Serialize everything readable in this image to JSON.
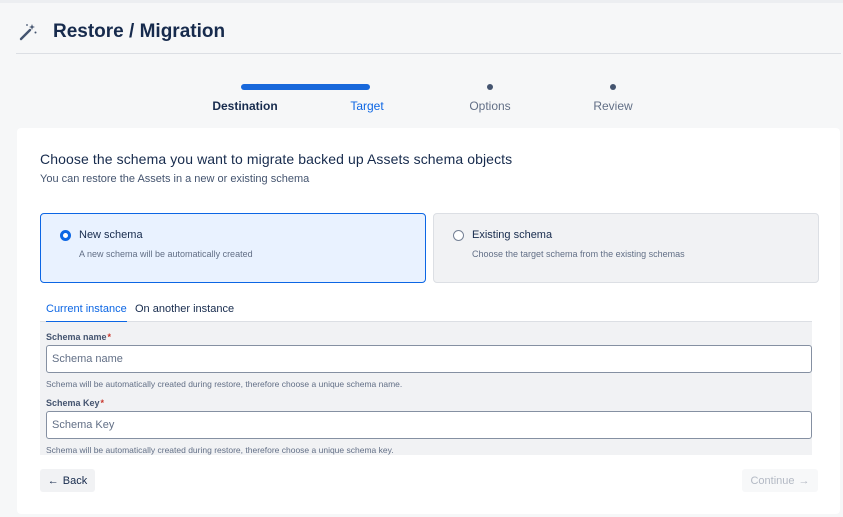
{
  "header": {
    "title": "Restore / Migration",
    "icon": "magic-wand-icon"
  },
  "steps": [
    {
      "label": "Destination",
      "state": "done"
    },
    {
      "label": "Target",
      "state": "active"
    },
    {
      "label": "Options",
      "state": "pending"
    },
    {
      "label": "Review",
      "state": "pending"
    }
  ],
  "main": {
    "heading": "Choose the schema you want to migrate backed up Assets schema objects",
    "subheading": "You can restore the Assets in a new or existing schema",
    "options": [
      {
        "title": "New schema",
        "description": "A new schema will be automatically created",
        "selected": true
      },
      {
        "title": "Existing schema",
        "description": "Choose the target schema from the existing schemas",
        "selected": false
      }
    ],
    "tabs": [
      {
        "label": "Current instance",
        "active": true
      },
      {
        "label": "On another instance",
        "active": false
      }
    ],
    "fields": {
      "schema_name": {
        "label": "Schema name",
        "required_mark": "*",
        "placeholder": "Schema name",
        "value": "",
        "help": "Schema will be automatically created during restore, therefore choose a unique schema name."
      },
      "schema_key": {
        "label": "Schema Key",
        "required_mark": "*",
        "placeholder": "Schema Key",
        "value": "",
        "help": "Schema will be automatically created during restore, therefore choose a unique schema key."
      }
    }
  },
  "footer": {
    "back_icon": "←",
    "back_label": "Back",
    "continue_label": "Continue",
    "continue_icon": "→",
    "continue_enabled": false
  },
  "colors": {
    "accent": "#0c66e4",
    "selected_bg": "#e9f2ff",
    "text": "#172b4d",
    "required": "#c9372c"
  }
}
